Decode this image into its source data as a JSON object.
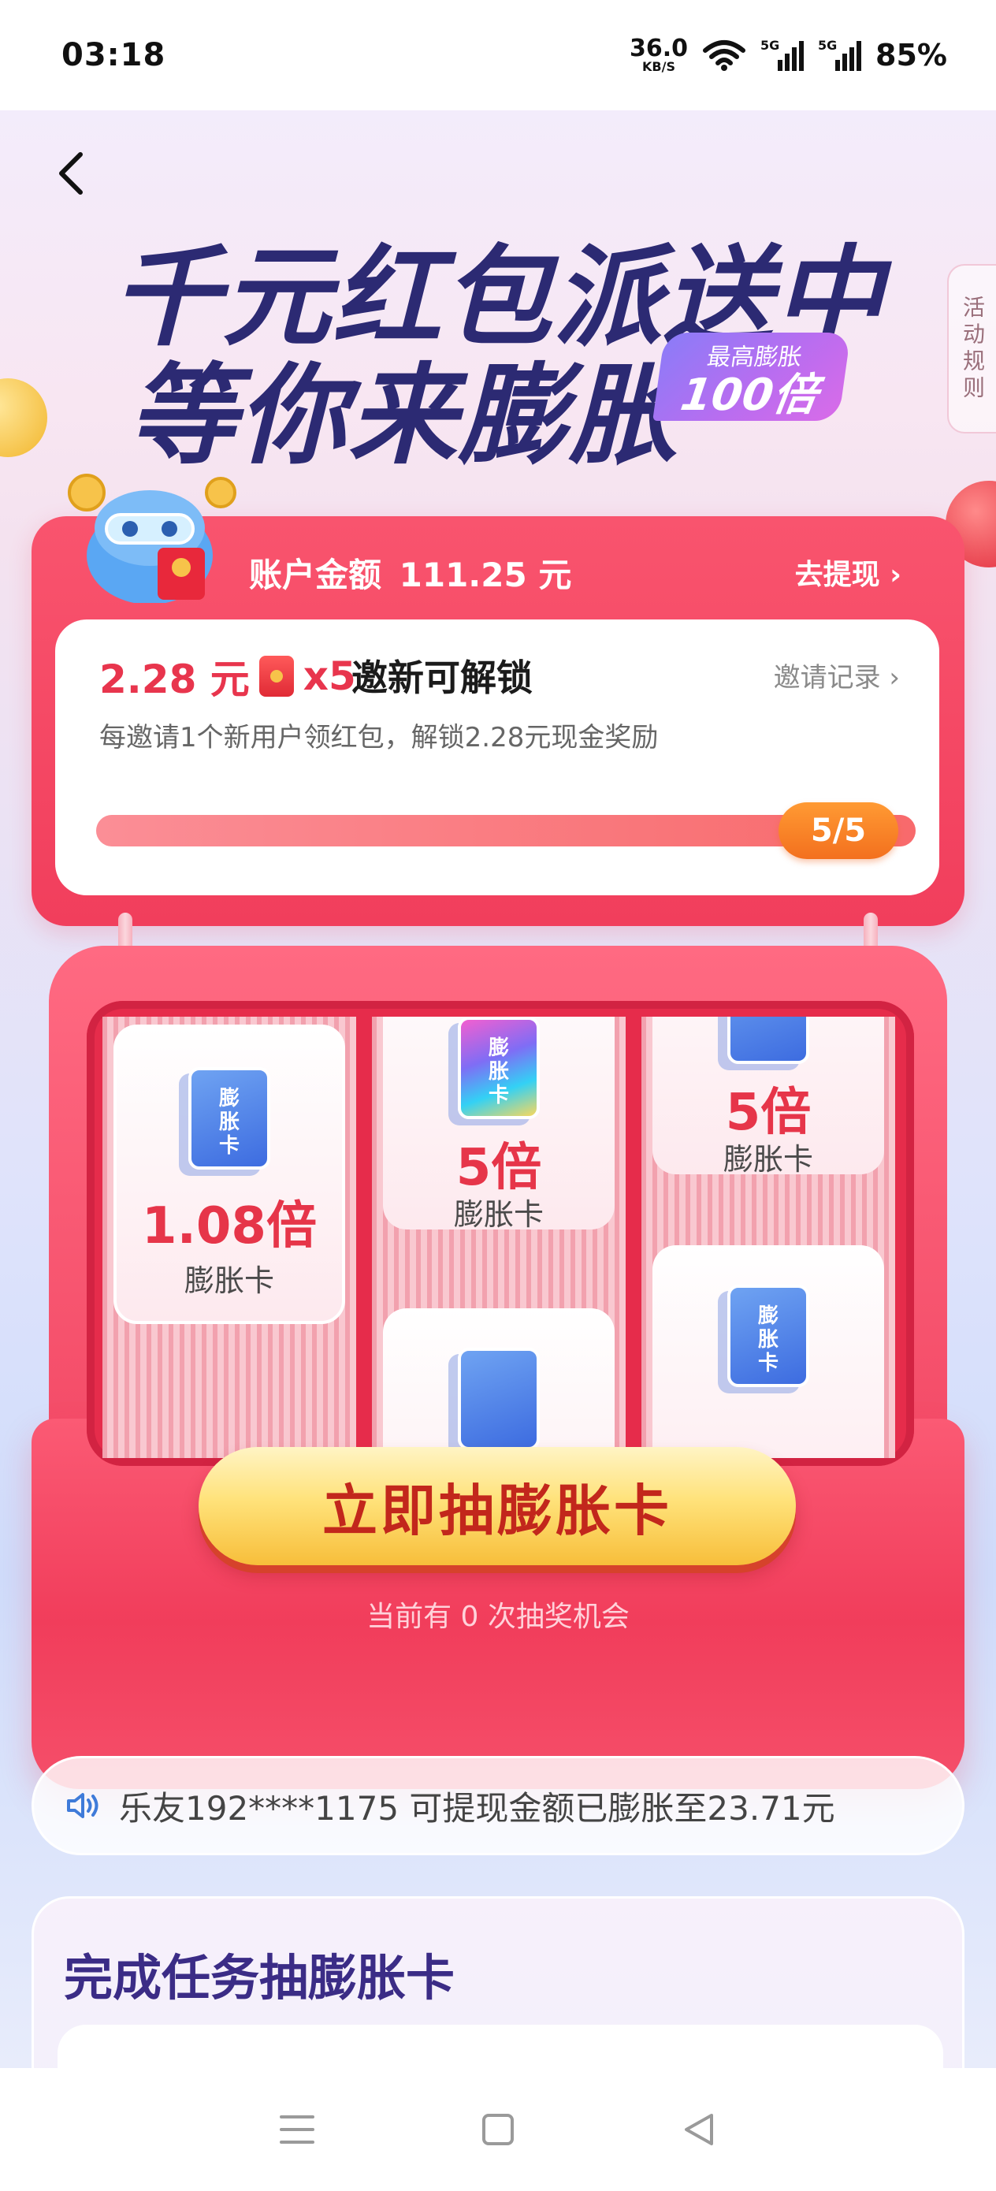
{
  "status_bar": {
    "time": "03:18",
    "net_speed": "36.0",
    "net_unit": "KB/S",
    "sig1_label": "5G",
    "sig2_label": "5G",
    "battery": "85%"
  },
  "header": {
    "headline_line1": "千元红包派送中",
    "headline_line2": "等你来膨胀",
    "badge_top": "最高膨胀",
    "badge_bottom": "100倍",
    "rules_tab": "活动规则"
  },
  "account": {
    "label": "账户金额",
    "amount": "111.25 元",
    "withdraw_label": "去提现 ›"
  },
  "invite": {
    "amount_text": "2.28 元",
    "multiplier": "x5",
    "unlock_label": "邀新可解锁",
    "record_link": "邀请记录 ›",
    "description": "每邀请1个新用户领红包，解锁2.28元现金奖励",
    "progress_text": "5/5",
    "progress_fraction": 1.0
  },
  "slot_machine": {
    "reel1": {
      "card_text": "膨\n胀\n卡",
      "multiplier": "1.08倍",
      "label": "膨胀卡"
    },
    "reel2": {
      "card_text": "膨\n胀\n卡",
      "multiplier": "5倍",
      "label": "膨胀卡"
    },
    "reel3": {
      "card_text": "膨\n胀\n卡",
      "multiplier": "5倍",
      "label": "膨胀卡"
    },
    "draw_button": "立即抽膨胀卡",
    "chances_text": "当前有 0 次抽奖机会"
  },
  "notice": {
    "text": "乐友192****1175 可提现金额已膨胀至23.71元"
  },
  "tasks": {
    "title": "完成任务抽膨胀卡"
  },
  "colors": {
    "primary_red": "#f13e5c",
    "headline_navy": "#2c2a73",
    "progress_orange": "#f3701e",
    "button_gold": "#ffe27a"
  }
}
